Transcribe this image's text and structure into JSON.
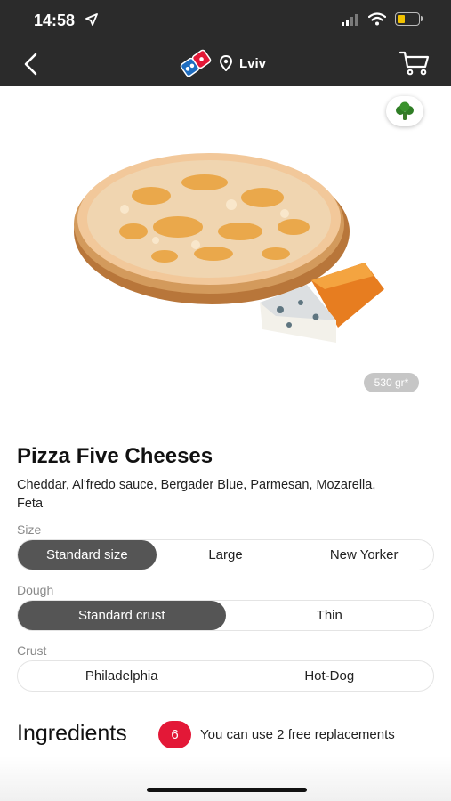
{
  "status": {
    "time": "14:58"
  },
  "header": {
    "city": "Lviv"
  },
  "product": {
    "weight": "530 gr*",
    "title": "Pizza Five Cheeses",
    "description": "Cheddar, Al'fredo sauce, Bergader Blue, Parmesan, Mozarella, Feta"
  },
  "size": {
    "label": "Size",
    "options": [
      "Standard size",
      "Large",
      "New Yorker"
    ],
    "selected": "Standard size"
  },
  "dough": {
    "label": "Dough",
    "options": [
      "Standard crust",
      "Thin"
    ],
    "selected": "Standard crust"
  },
  "crust": {
    "label": "Crust",
    "options": [
      "Philadelphia",
      "Hot-Dog"
    ]
  },
  "ingredients": {
    "title": "Ingredients",
    "count": "6",
    "note": "You can use 2 free replacements"
  },
  "icons": [
    "location-arrow-icon",
    "signal-icon",
    "wifi-icon",
    "battery-icon",
    "back-chevron-icon",
    "dominos-logo",
    "location-pin-icon",
    "cart-icon",
    "broccoli-icon"
  ],
  "colors": {
    "topbar": "#2b2b2b",
    "active_option": "#555555",
    "badge": "#e31837",
    "battery": "#f2c200"
  }
}
